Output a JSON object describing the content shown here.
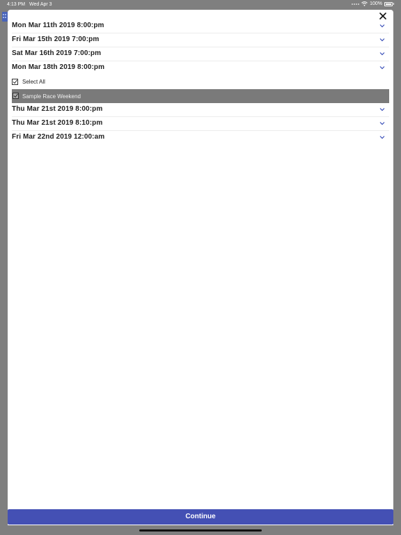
{
  "status_bar": {
    "time": "4:13 PM",
    "date": "Wed Apr 3",
    "battery": "100%"
  },
  "list": {
    "rows_before": [
      {
        "label": "Mon Mar 11th 2019 8:00:pm"
      },
      {
        "label": "Fri Mar 15th 2019 7:00:pm"
      },
      {
        "label": "Sat Mar 16th 2019 7:00:pm"
      },
      {
        "label": "Mon Mar 18th 2019 8:00:pm"
      }
    ],
    "expanded": {
      "select_all_label": "Select All",
      "item_label": "Sample Race Weekend"
    },
    "rows_after": [
      {
        "label": "Thu Mar 21st 2019 8:00:pm"
      },
      {
        "label": "Thu Mar 21st 2019 8:10:pm"
      },
      {
        "label": "Fri Mar 22nd 2019 12:00:am"
      }
    ]
  },
  "footer": {
    "continue_label": "Continue"
  },
  "colors": {
    "accent": "#4450b4",
    "chevron": "#3a4fb8",
    "selected_row": "#7a7a7a"
  }
}
